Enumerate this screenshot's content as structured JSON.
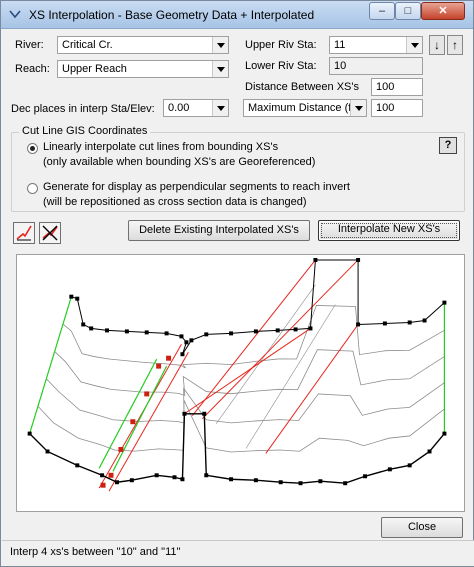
{
  "window": {
    "title": "XS Interpolation  - Base Geometry Data + Interpolated",
    "minimize": "–",
    "maximize": "□",
    "close": "✕"
  },
  "form": {
    "river_label": "River:",
    "river_value": "Critical Cr.",
    "reach_label": "Reach:",
    "reach_value": "Upper Reach",
    "dec_label": "Dec places in interp Sta/Elev:",
    "dec_value": "0.00",
    "upper_label": "Upper Riv Sta:",
    "upper_value": "11",
    "lower_label": "Lower Riv Sta:",
    "lower_value": "10",
    "distance_label": "Distance Between XS's",
    "distance_value": "100",
    "maxdist_option": "Maximum Distance (ft)",
    "maxdist_value": "100",
    "down_arrow": "↓",
    "up_arrow": "↑"
  },
  "gis": {
    "title": "Cut Line GIS Coordinates",
    "option1_line1": "Linearly interpolate cut lines from bounding XS's",
    "option1_line2": "(only available when bounding XS's are Georeferenced)",
    "option2_line1": "Generate for display as perpendicular segments to reach invert",
    "option2_line2": "(will be repositioned as cross section data is changed)",
    "help": "?"
  },
  "buttons": {
    "delete": "Delete Existing Interpolated XS's",
    "interpolate": "Interpolate New XS's",
    "close": "Close"
  },
  "status": "Interp 4 xs's between \"10\" and \"11\"",
  "colors": {
    "accent_red": "#e8261c",
    "accent_green": "#22cc22",
    "grid_gray": "#8c8c8c"
  },
  "icons": [
    "menu-icon",
    "edit-line-icon",
    "clear-lines-icon"
  ]
}
